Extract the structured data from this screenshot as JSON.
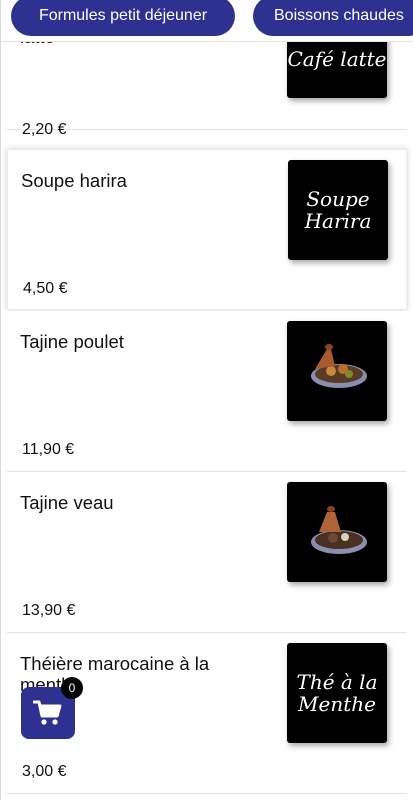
{
  "tabs": [
    {
      "label": "Formules petit déjeuner"
    },
    {
      "label": "Boissons chaudes"
    }
  ],
  "products": [
    {
      "name": "latte",
      "price": "2,20 €",
      "image_text_1": "Café latte",
      "image_text_2": ""
    },
    {
      "name": "Soupe harira",
      "price": "4,50 €",
      "image_text_1": "Soupe",
      "image_text_2": "Harira"
    },
    {
      "name": "Tajine poulet",
      "price": "11,90 €",
      "image_icon": "tajine-icon"
    },
    {
      "name": "Tajine veau",
      "price": "13,90 €",
      "image_icon": "tajine-icon"
    },
    {
      "name": "Théière marocaine à la menthe",
      "price": "3,00 €",
      "image_text_1": "Thé à la",
      "image_text_2": "Menthe"
    }
  ],
  "cart": {
    "count": "0",
    "icon": "cart-icon"
  },
  "colors": {
    "accent": "#2e3190",
    "badge": "#000000"
  }
}
